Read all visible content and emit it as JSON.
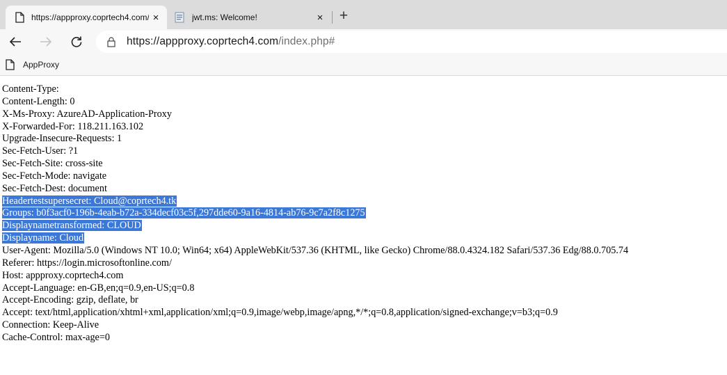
{
  "browser": {
    "tabs": [
      {
        "title": "https://appproxy.coprtech4.com/",
        "active": true,
        "close": "×"
      },
      {
        "title": "jwt.ms: Welcome!",
        "active": false,
        "close": "×"
      }
    ],
    "new_tab": "+",
    "address": {
      "host": "https://appproxy.coprtech4.com",
      "path": "/index.php#"
    },
    "favorites": [
      {
        "label": "AppProxy",
        "icon": "page-icon"
      }
    ]
  },
  "page": {
    "lines": [
      {
        "text": "Content-Type:",
        "selected": false
      },
      {
        "text": "Content-Length: 0",
        "selected": false
      },
      {
        "text": "X-Ms-Proxy: AzureAD-Application-Proxy",
        "selected": false
      },
      {
        "text": "X-Forwarded-For: 118.211.163.102",
        "selected": false
      },
      {
        "text": "Upgrade-Insecure-Requests: 1",
        "selected": false
      },
      {
        "text": "Sec-Fetch-User: ?1",
        "selected": false
      },
      {
        "text": "Sec-Fetch-Site: cross-site",
        "selected": false
      },
      {
        "text": "Sec-Fetch-Mode: navigate",
        "selected": false
      },
      {
        "text": "Sec-Fetch-Dest: document",
        "selected": false
      },
      {
        "text": "Headertestsupersecret: Cloud@coprtech4.tk",
        "selected": true
      },
      {
        "text": "Groups: b0f3acf0-196b-4eab-b72a-334decf03c5f,297dde60-9a16-4814-ab76-9c7a2f8c1275",
        "selected": true
      },
      {
        "text": "Displaynametransformed: CLOUD",
        "selected": true
      },
      {
        "text": "Displayname: Cloud",
        "selected": true
      },
      {
        "text": "User-Agent: Mozilla/5.0 (Windows NT 10.0; Win64; x64) AppleWebKit/537.36 (KHTML, like Gecko) Chrome/88.0.4324.182 Safari/537.36 Edg/88.0.705.74",
        "selected": false
      },
      {
        "text": "Referer: https://login.microsoftonline.com/",
        "selected": false
      },
      {
        "text": "Host: appproxy.coprtech4.com",
        "selected": false
      },
      {
        "text": "Accept-Language: en-GB,en;q=0.9,en-US;q=0.8",
        "selected": false
      },
      {
        "text": "Accept-Encoding: gzip, deflate, br",
        "selected": false
      },
      {
        "text": "Accept: text/html,application/xhtml+xml,application/xml;q=0.9,image/webp,image/apng,*/*;q=0.8,application/signed-exchange;v=b3;q=0.9",
        "selected": false
      },
      {
        "text": "Connection: Keep-Alive",
        "selected": false
      },
      {
        "text": "Cache-Control: max-age=0",
        "selected": false
      }
    ],
    "selection_color": "#3b78d8"
  }
}
